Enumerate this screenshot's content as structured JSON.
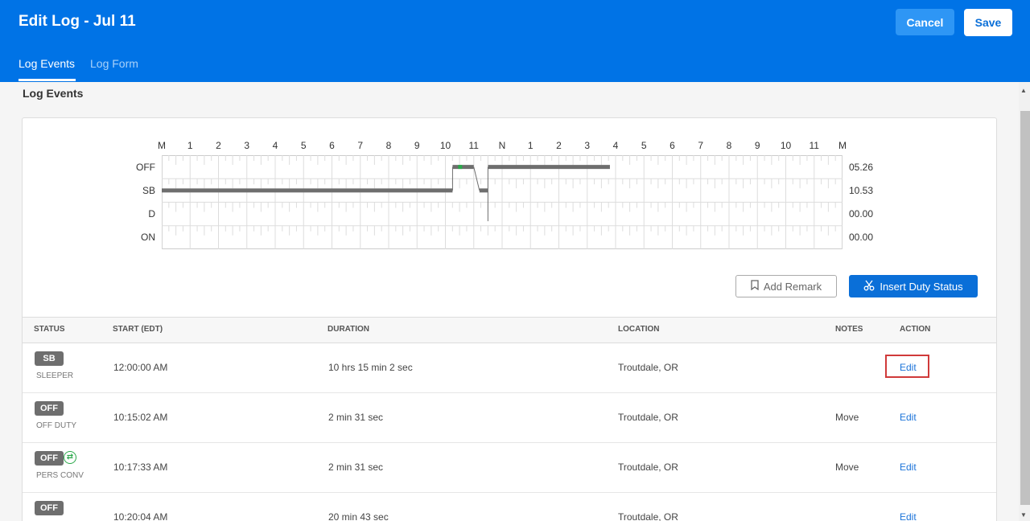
{
  "header": {
    "title": "Edit Log - Jul 11",
    "cancel_label": "Cancel",
    "save_label": "Save",
    "tabs": [
      {
        "label": "Log Events"
      },
      {
        "label": "Log Form"
      }
    ]
  },
  "section_title": "Log Events",
  "graph": {
    "hour_labels": [
      "M",
      "1",
      "2",
      "3",
      "4",
      "5",
      "6",
      "7",
      "8",
      "9",
      "10",
      "11",
      "N",
      "1",
      "2",
      "3",
      "4",
      "5",
      "6",
      "7",
      "8",
      "9",
      "10",
      "11",
      "M"
    ],
    "rows": [
      {
        "label": "OFF",
        "total": "05.26"
      },
      {
        "label": "SB",
        "total": "10.53"
      },
      {
        "label": "D",
        "total": "00.00"
      },
      {
        "label": "ON",
        "total": "00.00"
      }
    ],
    "segments": [
      {
        "status": "SB",
        "start": 0.0,
        "end": 10.253
      },
      {
        "status": "OFF",
        "start": 10.253,
        "end": 11.0
      },
      {
        "status": "SB",
        "start": 11.2,
        "end": 11.5
      },
      {
        "status": "OFF",
        "start": 11.5,
        "end": 15.8
      }
    ],
    "accent_color": "#2aa84a"
  },
  "actions": {
    "add_remark_label": "Add Remark",
    "insert_duty_label": "Insert Duty Status"
  },
  "table": {
    "headers": {
      "status": "STATUS",
      "start": "START (EDT)",
      "duration": "DURATION",
      "location": "LOCATION",
      "notes": "NOTES",
      "action": "ACTION"
    },
    "rows": [
      {
        "badge": "SB",
        "status_text": "SLEEPER",
        "start": "12:00:00 AM",
        "duration": "10 hrs 15 min 2 sec",
        "location": "Troutdale, OR",
        "notes": "",
        "action": "Edit"
      },
      {
        "badge": "OFF",
        "status_text": "OFF DUTY",
        "start": "10:15:02 AM",
        "duration": "2 min 31 sec",
        "location": "Troutdale, OR",
        "notes": "Move",
        "action": "Edit"
      },
      {
        "badge": "OFF",
        "status_text": "PERS CONV",
        "start": "10:17:33 AM",
        "duration": "2 min 31 sec",
        "location": "Troutdale, OR",
        "notes": "Move",
        "action": "Edit"
      },
      {
        "badge": "OFF",
        "status_text": "",
        "start": "10:20:04 AM",
        "duration": "20 min 43 sec",
        "location": "Troutdale, OR",
        "notes": "",
        "action": "Edit"
      }
    ]
  }
}
